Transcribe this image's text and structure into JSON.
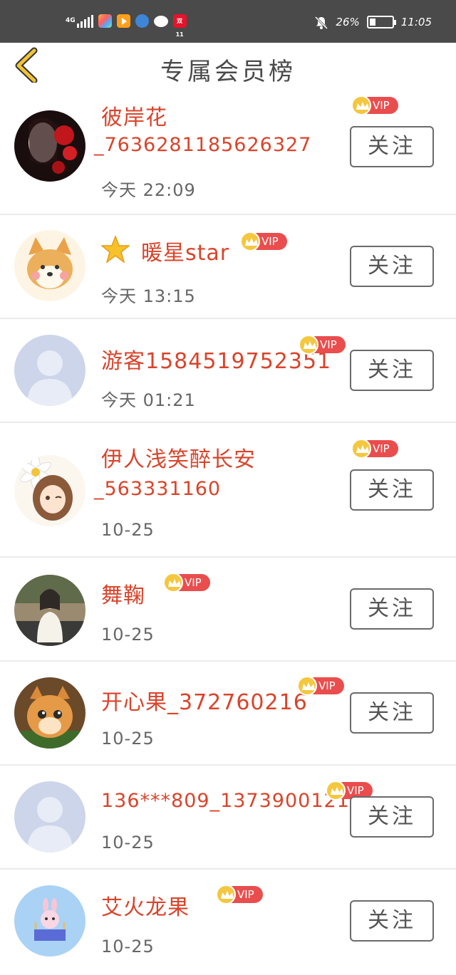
{
  "status_bar": {
    "network": "4G",
    "battery": "26%",
    "battery_level": 0.26,
    "time": "11:05",
    "notification_badge": "双11"
  },
  "header": {
    "back_icon": "chevron-left-icon",
    "title": "专属会员榜"
  },
  "vip_label": "VIP",
  "follow_label": "关注",
  "members": [
    {
      "name_line1": "彼岸花",
      "name_line2": "_7636281185626327",
      "time": "今天 22:09",
      "avatar": "red-flower-portrait",
      "has_star": false
    },
    {
      "name_line1": "暖星star",
      "name_line2": "",
      "time": "今天 13:15",
      "avatar": "shiba-dog",
      "has_star": true
    },
    {
      "name_line1": "游客1584519752351",
      "name_line2": "",
      "time": "今天 01:21",
      "avatar": "default-avatar",
      "has_star": false
    },
    {
      "name_line1": "伊人浅笑醉长安",
      "name_line2": "_563331160",
      "time": "10-25",
      "avatar": "anime-girl-flower",
      "has_star": false
    },
    {
      "name_line1": "舞鞠",
      "name_line2": "",
      "time": "10-25",
      "avatar": "woman-photo",
      "has_star": false
    },
    {
      "name_line1": "开心果_372760216",
      "name_line2": "",
      "time": "10-25",
      "avatar": "orange-kitten",
      "has_star": false
    },
    {
      "name_line1": "136***809_1373900121",
      "name_line2": "",
      "time": "10-25",
      "avatar": "default-avatar",
      "has_star": false
    },
    {
      "name_line1": "艾火龙果",
      "name_line2": "",
      "time": "10-25",
      "avatar": "pink-bunny-cartoon",
      "has_star": false
    }
  ],
  "colors": {
    "name": "#d9442b",
    "vip_pill": "#ea4d4d",
    "crown": "#f4c73e",
    "status_bar": "#4a4a4a"
  }
}
